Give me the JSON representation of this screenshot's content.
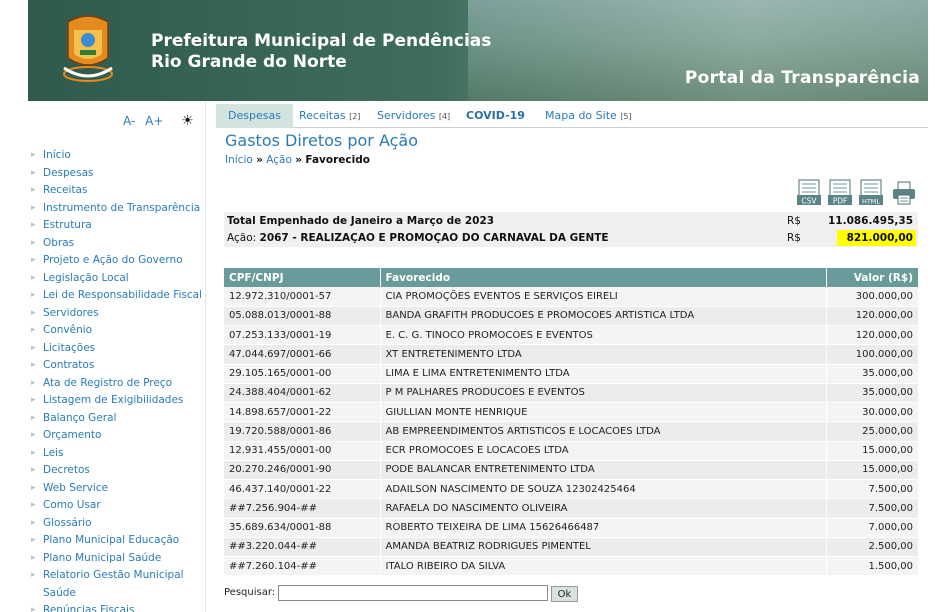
{
  "header": {
    "title_line1": "Prefeitura Municipal de Pendências",
    "title_line2": "Rio Grande do Norte",
    "portal": "Portal da Transparência"
  },
  "font_controls": {
    "decrease": "A-",
    "increase": "A+",
    "contrast_icon": "sun-icon"
  },
  "sidebar": {
    "items": [
      "Início",
      "Despesas",
      "Receitas",
      "Instrumento de Transparência",
      "Estrutura",
      "Obras",
      "Projeto e Ação do Governo",
      "Legislação Local",
      "Lei de Responsabilidade Fiscal",
      "Servidores",
      "Convênio",
      "Licitações",
      "Contratos",
      "Ata de Registro de Preço",
      "Listagem de Exigibilidades",
      "Balanço Geral",
      "Orçamento",
      "Leis",
      "Decretos",
      "Web Service",
      "Como Usar",
      "Glossário",
      "Plano Municipal Educação",
      "Plano Municipal Saúde",
      "Relatorio Gestão Municipal Saúde",
      "Renúncias Fiscais"
    ]
  },
  "tabs": [
    {
      "label": "Despesas",
      "count": ""
    },
    {
      "label": "Receitas",
      "count": "[2]"
    },
    {
      "label": "Servidores",
      "count": "[4]"
    },
    {
      "label": "COVID-19",
      "count": ""
    },
    {
      "label": "Mapa do Site",
      "count": "[5]"
    }
  ],
  "page": {
    "title": "Gastos Diretos por Ação",
    "breadcrumb": {
      "home": "Início",
      "sep": "»",
      "action": "Ação",
      "current": "Favorecido"
    }
  },
  "exports": [
    "CSV",
    "PDF",
    "HTML"
  ],
  "totals": {
    "label1": "Total Empenhado de Janeiro a Março de 2023",
    "currency": "R$",
    "value1": "11.086.495,35",
    "label2_prefix": "Ação:",
    "label2": "2067 - REALIZAÇAO E PROMOÇAO DO CARNAVAL DA GENTE",
    "value2": "821.000,00",
    "highlight_color": "#ffff00"
  },
  "table": {
    "headers": [
      "CPF/CNPJ",
      "Favorecido",
      "Valor (R$)"
    ],
    "rows": [
      [
        "12.972.310/0001-57",
        "CIA PROMOÇÕES EVENTOS E SERVIÇOS EIRELI",
        "300.000,00"
      ],
      [
        "05.088.013/0001-88",
        "BANDA GRAFITH PRODUCOES E PROMOCOES ARTISTICA LTDA",
        "120.000,00"
      ],
      [
        "07.253.133/0001-19",
        "E. C. G. TINOCO PROMOCOES E EVENTOS",
        "120.000,00"
      ],
      [
        "47.044.697/0001-66",
        "XT ENTRETENIMENTO LTDA",
        "100.000,00"
      ],
      [
        "29.105.165/0001-00",
        "LIMA E LIMA ENTRETENIMENTO LTDA",
        "35.000,00"
      ],
      [
        "24.388.404/0001-62",
        "P M PALHARES PRODUCOES E EVENTOS",
        "35.000,00"
      ],
      [
        "14.898.657/0001-22",
        "GIULLIAN MONTE HENRIQUE",
        "30.000,00"
      ],
      [
        "19.720.588/0001-86",
        "AB EMPREENDIMENTOS ARTISTICOS E LOCACOES LTDA",
        "25.000,00"
      ],
      [
        "12.931.455/0001-00",
        "ECR PROMOCOES E LOCACOES LTDA",
        "15.000,00"
      ],
      [
        "20.270.246/0001-90",
        "PODE BALANCAR ENTRETENIMENTO LTDA",
        "15.000,00"
      ],
      [
        "46.437.140/0001-22",
        "ADAILSON NASCIMENTO DE SOUZA 12302425464",
        "7.500,00"
      ],
      [
        "##7.256.904-##",
        "RAFAELA DO NASCIMENTO OLIVEIRA",
        "7.500,00"
      ],
      [
        "35.689.634/0001-88",
        "ROBERTO TEIXEIRA DE LIMA 15626466487",
        "7.000,00"
      ],
      [
        "##3.220.044-##",
        "AMANDA BEATRIZ RODRIGUES PIMENTEL",
        "2.500,00"
      ],
      [
        "##7.260.104-##",
        "ITALO RIBEIRO DA SILVA",
        "1.500,00"
      ]
    ]
  },
  "search": {
    "label": "Pesquisar:",
    "value": "",
    "button": "Ok"
  },
  "colors": {
    "header_green": "#3e6d5d",
    "table_header": "#6a9b9b",
    "link": "#2a7cb5",
    "tab_active": "#d3e3e0"
  }
}
